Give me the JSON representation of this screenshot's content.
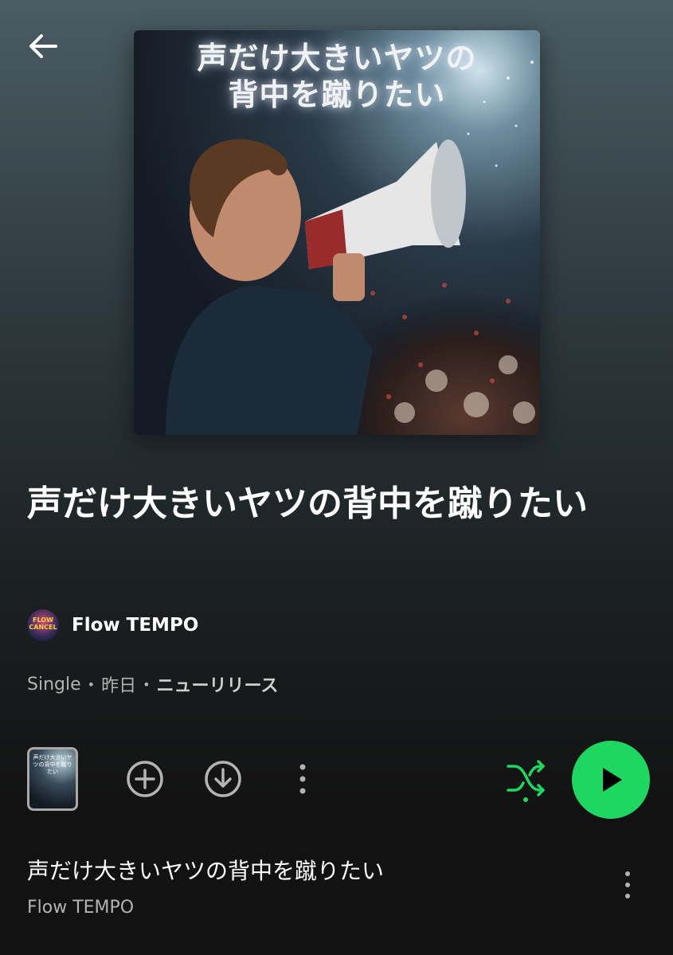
{
  "header": {
    "back_icon": "arrow-left-icon"
  },
  "album": {
    "cover_text_line1": "声だけ大きいヤツの",
    "cover_text_line2": "背中を蹴りたい",
    "title": "声だけ大きいヤツの背中を蹴りたい",
    "artist": "Flow TEMPO",
    "type": "Single",
    "date": "昨日",
    "release_tag": "ニューリリース",
    "separator": "•"
  },
  "controls": {
    "thumb_text": "声だけ大きいヤツの背中を蹴りたい",
    "add_icon": "plus-circle-icon",
    "download_icon": "download-circle-icon",
    "more_icon": "vertical-dots-icon",
    "shuffle_icon": "shuffle-icon",
    "play_icon": "play-icon",
    "accent_color": "#1ed760"
  },
  "tracks": [
    {
      "title": "声だけ大きいヤツの背中を蹴りたい",
      "artist": "Flow TEMPO"
    }
  ]
}
